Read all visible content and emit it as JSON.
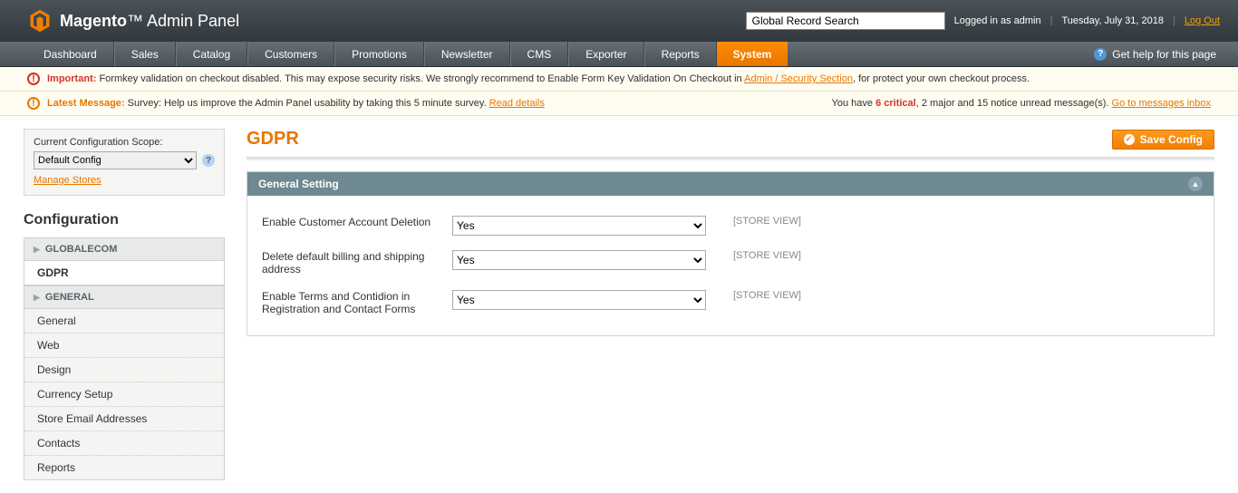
{
  "header": {
    "brand_main": "Magento",
    "brand_sub": "Admin Panel",
    "search_placeholder": "Global Record Search",
    "logged_in": "Logged in as admin",
    "date": "Tuesday, July 31, 2018",
    "logout": "Log Out"
  },
  "nav": {
    "items": [
      "Dashboard",
      "Sales",
      "Catalog",
      "Customers",
      "Promotions",
      "Newsletter",
      "CMS",
      "Exporter",
      "Reports",
      "System"
    ],
    "active": "System",
    "help": "Get help for this page"
  },
  "notice_important": {
    "label": "Important:",
    "text_before": " Formkey validation on checkout disabled. This may expose security risks. We strongly recommend to Enable Form Key Validation On Checkout in ",
    "link": "Admin / Security Section",
    "text_after": ", for protect your own checkout process."
  },
  "notice_latest": {
    "label": "Latest Message:",
    "text": " Survey: Help us improve the Admin Panel usability by taking this 5 minute survey. ",
    "link": "Read details",
    "right_before": "You have ",
    "critical": "6 critical",
    "right_mid": ", 2 major and 15 notice unread message(s). ",
    "right_link": "Go to messages inbox"
  },
  "sidebar": {
    "scope_label": "Current Configuration Scope:",
    "scope_value": "Default Config",
    "manage_stores": "Manage Stores",
    "config_title": "Configuration",
    "sections": [
      {
        "title": "GLOBALECOM",
        "items": [
          "GDPR"
        ],
        "active": "GDPR"
      },
      {
        "title": "GENERAL",
        "items": [
          "General",
          "Web",
          "Design",
          "Currency Setup",
          "Store Email Addresses",
          "Contacts",
          "Reports"
        ],
        "active": ""
      }
    ]
  },
  "page": {
    "title": "GDPR",
    "save": "Save Config"
  },
  "fieldset": {
    "title": "General Setting",
    "rows": [
      {
        "label": "Enable Customer Account Deletion",
        "value": "Yes",
        "scope": "[STORE VIEW]"
      },
      {
        "label": "Delete default billing and shipping address",
        "value": "Yes",
        "scope": "[STORE VIEW]"
      },
      {
        "label": "Enable Terms and Contidion in Registration and Contact Forms",
        "value": "Yes",
        "scope": "[STORE VIEW]"
      }
    ]
  }
}
